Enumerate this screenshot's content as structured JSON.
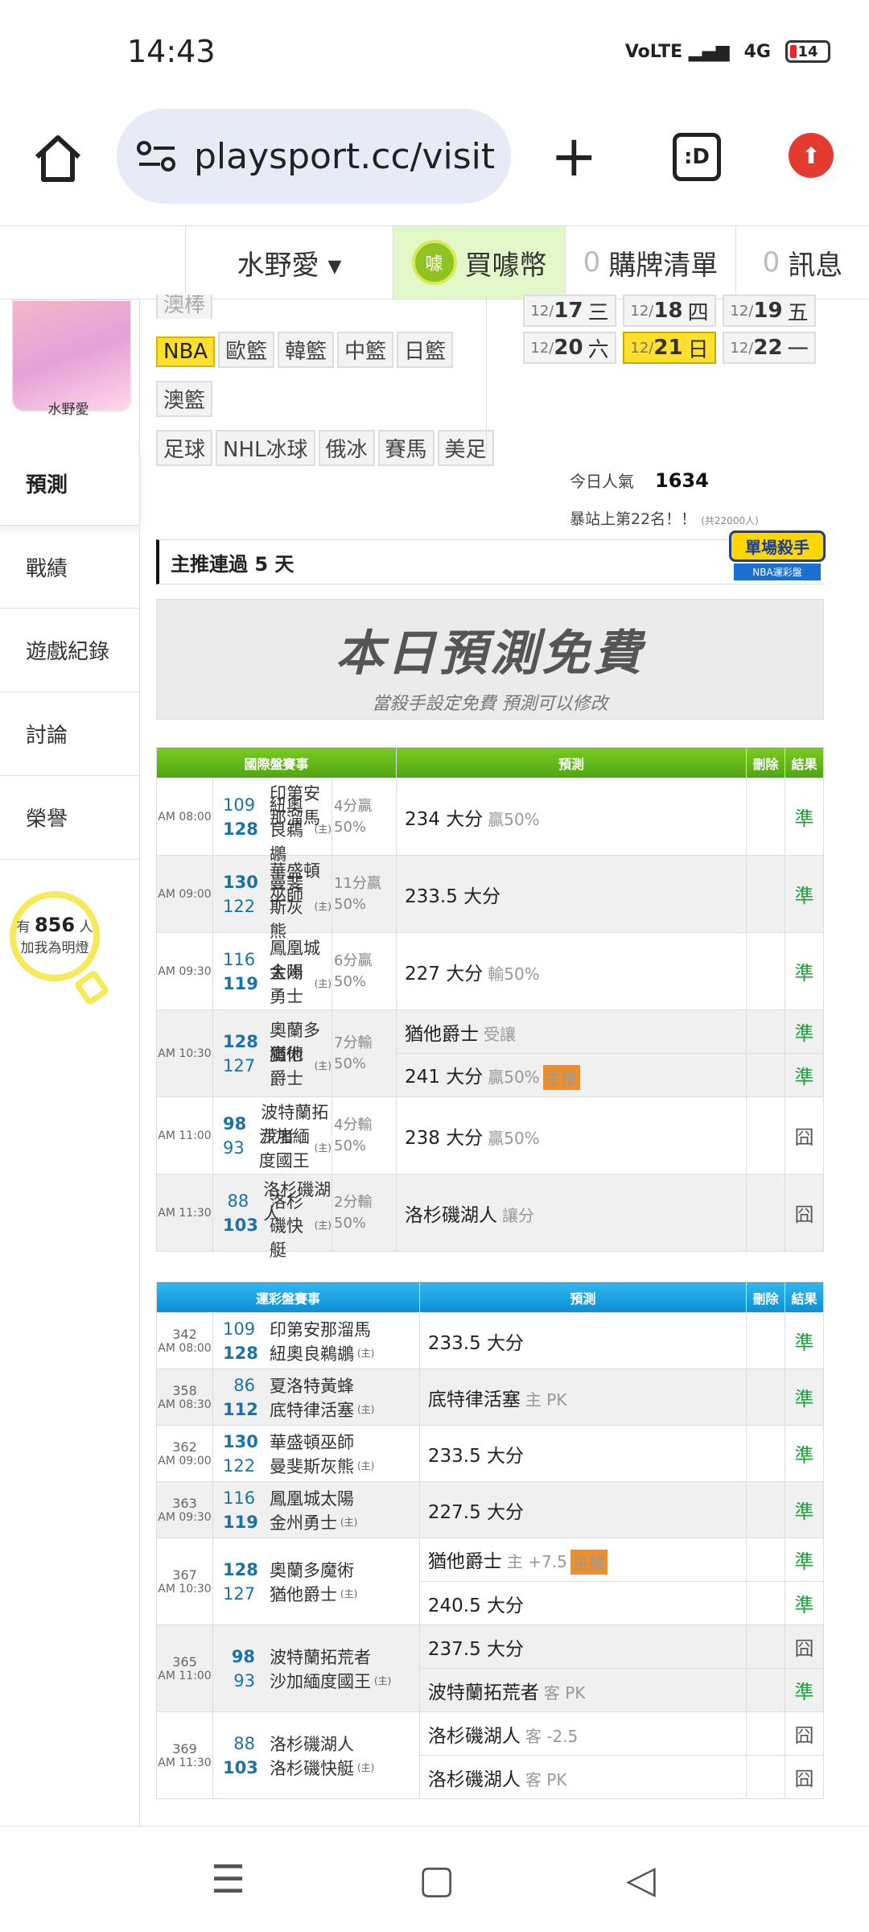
{
  "status": {
    "time": "14:43",
    "network": "4G",
    "battery": "14"
  },
  "browser": {
    "url": "playsport.cc/visit",
    "tab_label": ":D"
  },
  "topnav": {
    "user": "水野愛 ▾",
    "coin": "買噱幣",
    "coin_icon": "噱",
    "cart_count": "0",
    "cart": "購牌清單",
    "msg_count": "0",
    "msg": "訊息"
  },
  "profile": {
    "name": "水野愛"
  },
  "sidebar": {
    "items": [
      "預測",
      "戰績",
      "遊戲紀錄",
      "討論",
      "榮譽"
    ],
    "fans_prefix": "有",
    "fans_count": "856",
    "fans_unit": "人",
    "fans_text": "加我為明燈"
  },
  "leagues": {
    "partial": "澳棒",
    "row1": [
      "NBA",
      "歐籃",
      "韓籃",
      "中籃",
      "日籃"
    ],
    "row2": [
      "澳籃"
    ],
    "row3": [
      "足球",
      "NHL冰球",
      "俄冰",
      "賽馬",
      "美足"
    ]
  },
  "dates": [
    {
      "m": "12/",
      "d": "17",
      "w": "三"
    },
    {
      "m": "12/",
      "d": "18",
      "w": "四"
    },
    {
      "m": "12/",
      "d": "19",
      "w": "五"
    },
    {
      "m": "12/",
      "d": "20",
      "w": "六"
    },
    {
      "m": "12/",
      "d": "21",
      "w": "日"
    },
    {
      "m": "12/",
      "d": "22",
      "w": "一"
    }
  ],
  "popularity": {
    "label": "今日人氣",
    "value": "1634",
    "rank": "暴站上第22名！！",
    "total": "(共22000人)"
  },
  "streak": {
    "text": "主推連過 5 天",
    "badge_title": "單場殺手",
    "badge_sub": "NBA運彩盤"
  },
  "banner": {
    "title": "本日預測免費",
    "sub": "當殺手設定免費  預測可以修改"
  },
  "intl": {
    "headers": [
      "國際盤賽事",
      "預測",
      "刪除",
      "結果"
    ],
    "games": [
      {
        "time": "AM 08:00",
        "a": "109",
        "an": "印第安那溜馬",
        "as": 0,
        "b": "128",
        "bn": "紐奧良鵜鶘",
        "bs": 1,
        "res1": "4分贏",
        "res2": "50%",
        "preds": [
          {
            "t": "234 大分",
            "s": "贏50%",
            "tag": "",
            "r": "準"
          }
        ]
      },
      {
        "time": "AM 09:00",
        "a": "130",
        "an": "華盛頓巫師",
        "as": 1,
        "b": "122",
        "bn": "曼斐斯灰熊",
        "bs": 0,
        "res1": "11分贏",
        "res2": "50%",
        "preds": [
          {
            "t": "233.5 大分",
            "s": "",
            "tag": "",
            "r": "準"
          }
        ]
      },
      {
        "time": "AM 09:30",
        "a": "116",
        "an": "鳳凰城太陽",
        "as": 0,
        "b": "119",
        "bn": "金州勇士",
        "bs": 1,
        "res1": "6分贏",
        "res2": "50%",
        "preds": [
          {
            "t": "227 大分",
            "s": "輸50%",
            "tag": "",
            "r": "準"
          }
        ]
      },
      {
        "time": "AM 10:30",
        "a": "128",
        "an": "奧蘭多魔術",
        "as": 1,
        "b": "127",
        "bn": "猶他爵士",
        "bs": 0,
        "res1": "7分輸",
        "res2": "50%",
        "preds": [
          {
            "t": "猶他爵士",
            "s": "受讓",
            "tag": "",
            "r": "準"
          },
          {
            "t": "241 大分",
            "s": "贏50%",
            "tag": "主推",
            "r": "準"
          }
        ]
      },
      {
        "time": "AM 11:00",
        "a": "98",
        "an": "波特蘭拓荒者",
        "as": 1,
        "b": "93",
        "bn": "沙加緬度國王",
        "bs": 0,
        "res1": "4分輸",
        "res2": "50%",
        "preds": [
          {
            "t": "238 大分",
            "s": "贏50%",
            "tag": "",
            "r": "囧"
          }
        ]
      },
      {
        "time": "AM 11:30",
        "a": "88",
        "an": "洛杉磯湖人",
        "as": 0,
        "b": "103",
        "bn": "洛杉磯快艇",
        "bs": 1,
        "res1": "2分輸",
        "res2": "50%",
        "preds": [
          {
            "t": "洛杉磯湖人",
            "s": "讓分",
            "tag": "",
            "r": "囧"
          }
        ]
      }
    ]
  },
  "lottery": {
    "headers": [
      "運彩盤賽事",
      "預測",
      "刪除",
      "結果"
    ],
    "games": [
      {
        "no": "342",
        "time": "AM 08:00",
        "a": "109",
        "an": "印第安那溜馬",
        "as": 0,
        "b": "128",
        "bn": "紐奧良鵜鶘",
        "bs": 1,
        "preds": [
          {
            "t": "233.5 大分",
            "s": "",
            "tag": "",
            "r": "準"
          }
        ]
      },
      {
        "no": "358",
        "time": "AM 08:30",
        "a": "86",
        "an": "夏洛特黃蜂",
        "as": 0,
        "b": "112",
        "bn": "底特律活塞",
        "bs": 1,
        "preds": [
          {
            "t": "底特律活塞",
            "s": "主 PK",
            "tag": "",
            "r": "準"
          }
        ]
      },
      {
        "no": "362",
        "time": "AM 09:00",
        "a": "130",
        "an": "華盛頓巫師",
        "as": 1,
        "b": "122",
        "bn": "曼斐斯灰熊",
        "bs": 0,
        "preds": [
          {
            "t": "233.5 大分",
            "s": "",
            "tag": "",
            "r": "準"
          }
        ]
      },
      {
        "no": "363",
        "time": "AM 09:30",
        "a": "116",
        "an": "鳳凰城太陽",
        "as": 0,
        "b": "119",
        "bn": "金州勇士",
        "bs": 1,
        "preds": [
          {
            "t": "227.5 大分",
            "s": "",
            "tag": "",
            "r": "準"
          }
        ]
      },
      {
        "no": "367",
        "time": "AM 10:30",
        "a": "128",
        "an": "奧蘭多魔術",
        "as": 1,
        "b": "127",
        "bn": "猶他爵士",
        "bs": 0,
        "preds": [
          {
            "t": "猶他爵士",
            "s": "主 +7.5",
            "tag": "主推",
            "r": "準"
          },
          {
            "t": "240.5 大分",
            "s": "",
            "tag": "",
            "r": "準"
          }
        ]
      },
      {
        "no": "365",
        "time": "AM 11:00",
        "a": "98",
        "an": "波特蘭拓荒者",
        "as": 1,
        "b": "93",
        "bn": "沙加緬度國王",
        "bs": 0,
        "preds": [
          {
            "t": "237.5 大分",
            "s": "",
            "tag": "",
            "r": "囧"
          },
          {
            "t": "波特蘭拓荒者",
            "s": "客 PK",
            "tag": "",
            "r": "準"
          }
        ]
      },
      {
        "no": "369",
        "time": "AM 11:30",
        "a": "88",
        "an": "洛杉磯湖人",
        "as": 0,
        "b": "103",
        "bn": "洛杉磯快艇",
        "bs": 1,
        "preds": [
          {
            "t": "洛杉磯湖人",
            "s": "客 -2.5",
            "tag": "",
            "r": "囧"
          },
          {
            "t": "洛杉磯湖人",
            "s": "客 PK",
            "tag": "",
            "r": "囧"
          }
        ]
      }
    ]
  }
}
